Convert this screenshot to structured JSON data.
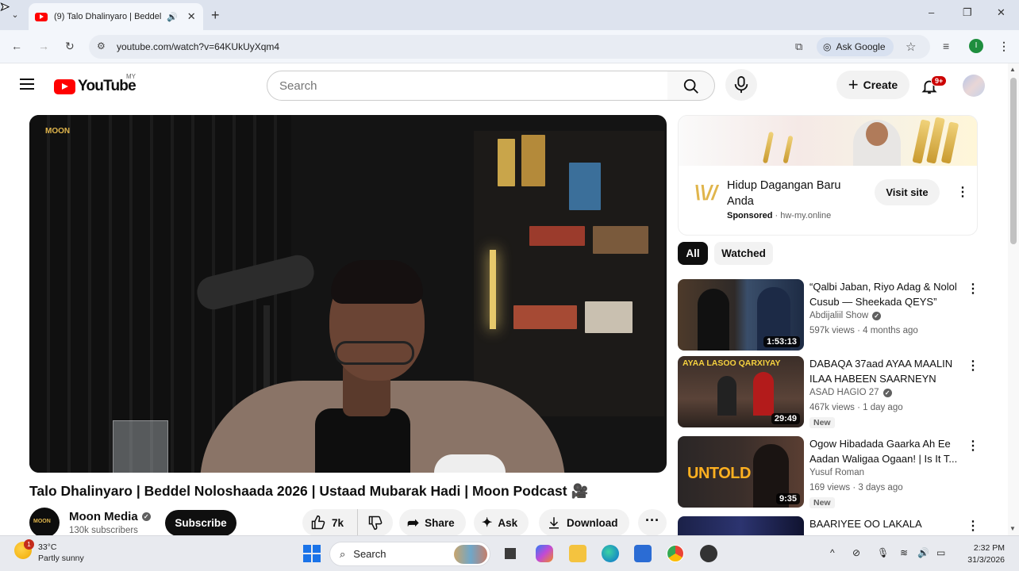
{
  "browser": {
    "tab_title": "(9) Talo Dhalinyaro | Beddel",
    "new_tab": "+",
    "url": "youtube.com/watch?v=64KUkUyXqm4",
    "ask_google": "Ask Google",
    "profile_initial": "I",
    "window_controls": {
      "minimize": "–",
      "maximize": "❐",
      "close": "✕"
    }
  },
  "youtube": {
    "logo_text": "YouTube",
    "country_code": "MY",
    "search_placeholder": "Search",
    "create_label": "Create",
    "notification_count": "9+"
  },
  "video": {
    "title": "Talo Dhalinyaro | Beddel Noloshaada 2026 | Ustaad Mubarak Hadi | Moon Podcast 🎥",
    "watermark": "MOON",
    "channel_name": "Moon Media",
    "subscribers": "130k subscribers",
    "subscribe_label": "Subscribe",
    "like_count": "7k",
    "share_label": "Share",
    "ask_label": "Ask",
    "download_label": "Download"
  },
  "ad": {
    "title": "Hidup Dagangan Baru Anda",
    "sponsored_label": "Sponsored",
    "domain": "· hw-my.online",
    "visit_label": "Visit site"
  },
  "chips": {
    "all": "All",
    "watched": "Watched"
  },
  "recommendations": [
    {
      "title": "“Qalbi Jaban, Riyo Adag & Nolol Cusub — Sheekada QEYS”",
      "channel": "Abdijaliil Show",
      "verified": true,
      "meta": "597k views · 4 months ago",
      "duration": "1:53:13",
      "badge": ""
    },
    {
      "title": "DABAQA 37aad AYAA MAALIN ILAA HABEEN SAARNEYN WA...",
      "channel": "ASAD HAGIO 27",
      "verified": true,
      "meta": "467k views · 1 day ago",
      "duration": "29:49",
      "badge": "New",
      "thumb_text": "AYAA LASOO QARXIYAY"
    },
    {
      "title": "Ogow Hibadada Gaarka Ah Ee Aadan Waligaa Ogaan! | Is It T...",
      "channel": "Yusuf Roman",
      "verified": false,
      "meta": "169 views · 3 days ago",
      "duration": "9:35",
      "badge": "New",
      "thumb_text": "UNTOLD"
    },
    {
      "title": "BAARIYEE OO LAKALA TUURAY",
      "channel": "",
      "verified": false,
      "meta": "",
      "duration": "",
      "badge": ""
    }
  ],
  "taskbar": {
    "temperature": "33°C",
    "weather": "Partly sunny",
    "weather_badge": "1",
    "search_label": "Search",
    "time": "2:32 PM",
    "date": "31/3/2026"
  },
  "colors": {
    "yt_red": "#ff0000",
    "accent_dark": "#0f0f0f",
    "muted": "#606060"
  }
}
